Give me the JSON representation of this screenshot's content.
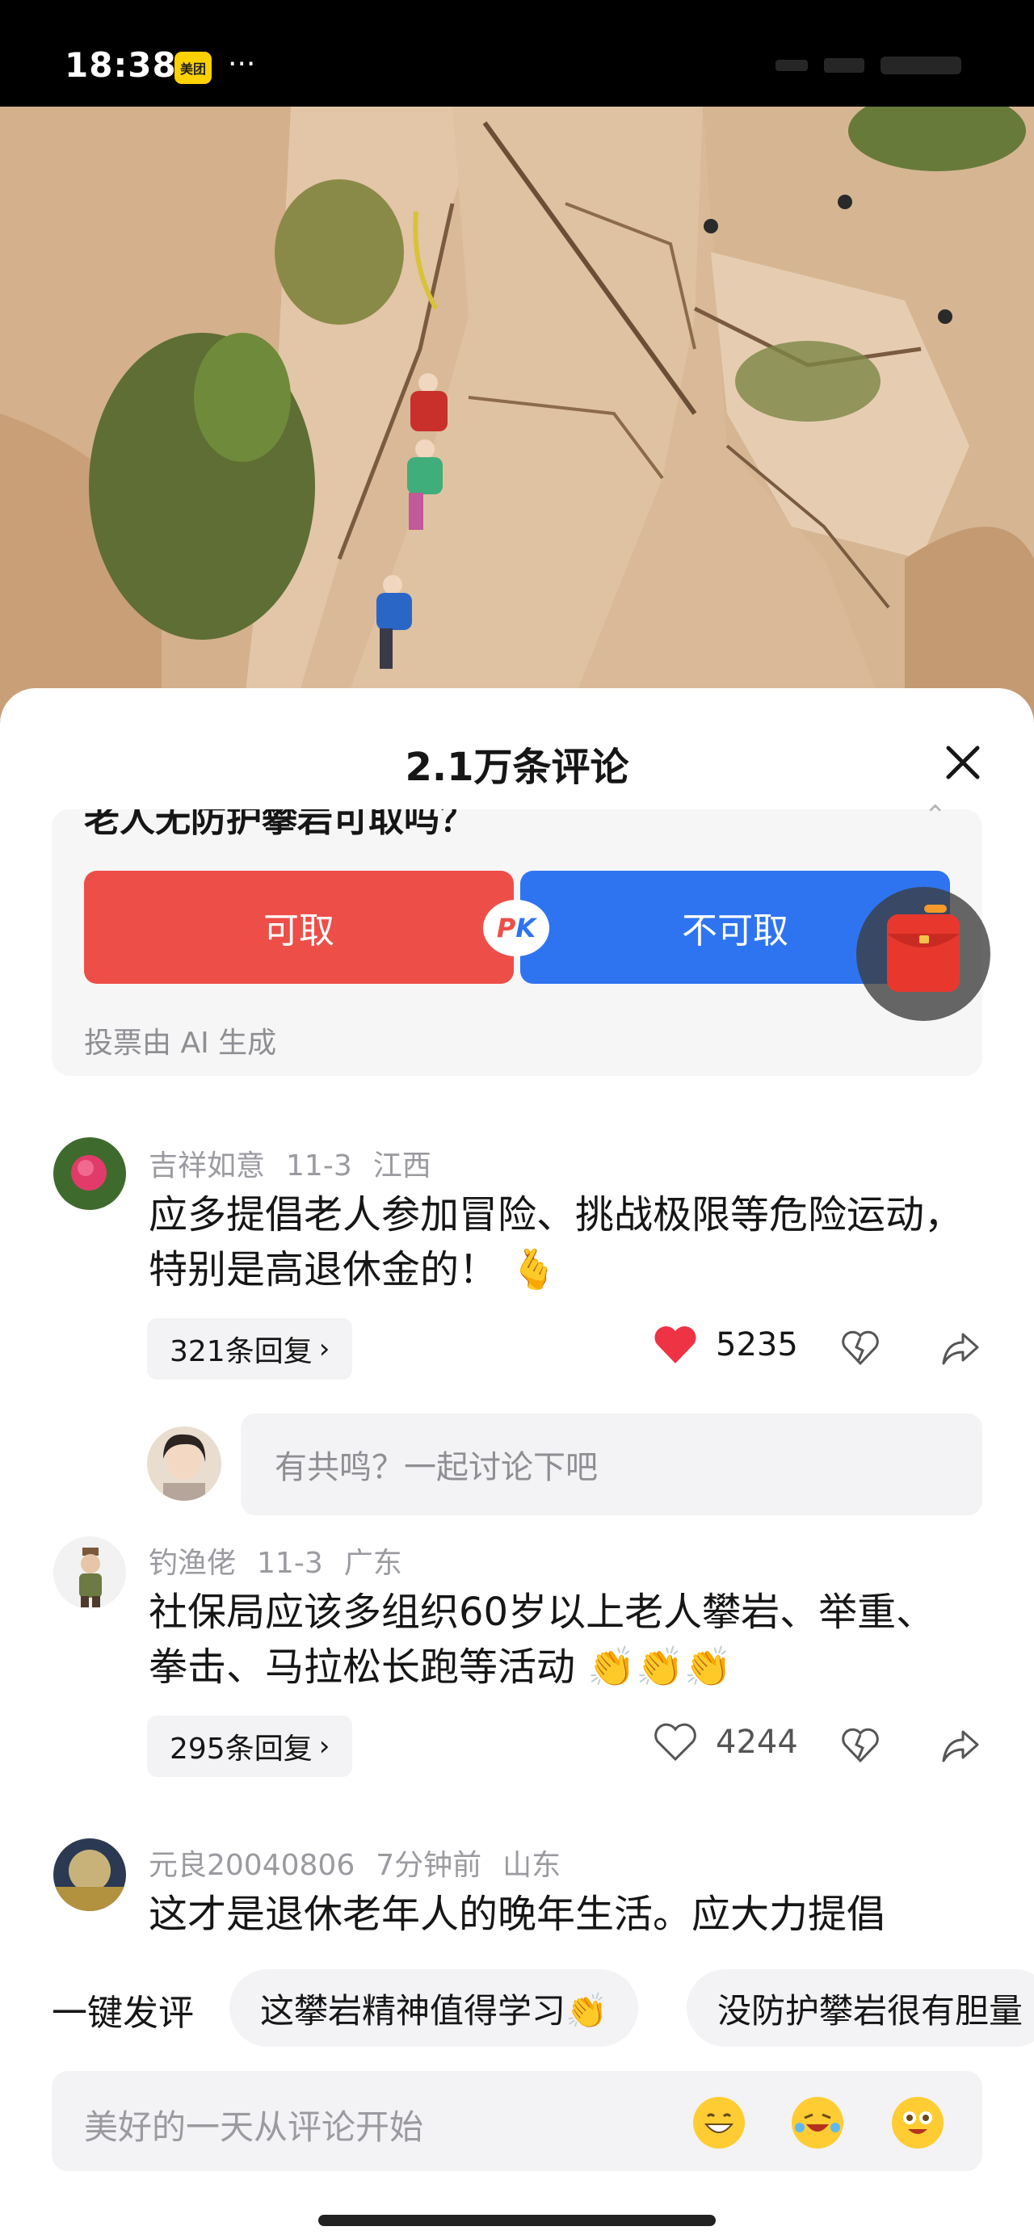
{
  "status_bar": {
    "time": "18:38",
    "app_badge": "美团",
    "more": "···"
  },
  "sheet": {
    "title": "2.1万条评论"
  },
  "poll": {
    "question": "老人无防护攀岩可取吗？",
    "option_yes": "可取",
    "option_no": "不可取",
    "pk": {
      "p": "P",
      "k": "K"
    },
    "note": "投票由 AI 生成"
  },
  "comments": [
    {
      "user": "吉祥如意",
      "date": "11-3",
      "location": "江西",
      "text": "应多提倡老人参加冒险、挑战极限等危险运动，特别是高退休金的！",
      "emoji_suffix": "🫰",
      "replies": "321条回复",
      "likes": "5235",
      "liked": true
    },
    {
      "user": "钓渔佬",
      "date": "11-3",
      "location": "广东",
      "text": "社保局应该多组织60岁以上老人攀岩、举重、拳击、马拉松长跑等活动",
      "emoji_suffix": "👏👏👏",
      "replies": "295条回复",
      "likes": "4244",
      "liked": false
    },
    {
      "user": "元良20040806",
      "date": "7分钟前",
      "location": "山东",
      "text": "这才是退休老年人的晚年生活。应大力提倡"
    }
  ],
  "reply_prompt": "有共鸣？一起讨论下吧",
  "quick_comments": {
    "label": "一键发评",
    "chips": [
      "这攀岩精神值得学习👏",
      "没防护攀岩很有胆量"
    ]
  },
  "input": {
    "placeholder": "美好的一天从评论开始"
  },
  "icons": {
    "close": "close-icon",
    "like": "heart-icon",
    "dislike": "broken-heart-icon",
    "share": "share-icon",
    "red_packet": "red-packet-icon",
    "collapse": "chevron-up-icon"
  },
  "colors": {
    "yes": "#ee4e48",
    "no": "#2e74f0",
    "liked": "#ee3344"
  }
}
